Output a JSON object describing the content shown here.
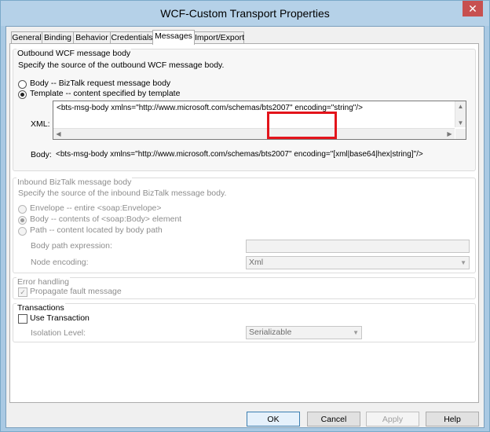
{
  "window": {
    "title": "WCF-Custom Transport Properties",
    "close_glyph": "✕"
  },
  "tabs": [
    "General",
    "Binding",
    "Behavior",
    "Credentials",
    "Messages",
    "Import/Export"
  ],
  "active_tab": "Messages",
  "outbound": {
    "title": "Outbound WCF message body",
    "description": "Specify the source of the outbound WCF message body.",
    "option_body": "Body -- BizTalk request message body",
    "option_template": "Template -- content specified by template",
    "selected": "template",
    "xml_label": "XML:",
    "xml_value": "<bts-msg-body xmlns=\"http://www.microsoft.com/schemas/bts2007\" encoding=\"string\"/>",
    "body_label": "Body:",
    "body_value": "<bts-msg-body xmlns=\"http://www.microsoft.com/schemas/bts2007\" encoding=\"[xml|base64|hex|string]\"/>"
  },
  "inbound": {
    "title": "Inbound BizTalk message body",
    "description": "Specify the source of the inbound BizTalk message body.",
    "option_envelope": "Envelope -- entire <soap:Envelope>",
    "option_body": "Body -- contents of <soap:Body> element",
    "option_path": "Path -- content located by body path",
    "selected": "body",
    "body_path_label": "Body path expression:",
    "body_path_value": "",
    "node_encoding_label": "Node encoding:",
    "node_encoding_value": "Xml"
  },
  "error_handling": {
    "title": "Error handling",
    "propagate_label": "Propagate fault message",
    "propagate_checked": true
  },
  "transactions": {
    "title": "Transactions",
    "use_transaction_label": "Use Transaction",
    "use_transaction_checked": false,
    "isolation_label": "Isolation Level:",
    "isolation_value": "Serializable"
  },
  "buttons": {
    "ok": "OK",
    "cancel": "Cancel",
    "apply": "Apply",
    "help": "Help"
  },
  "colors": {
    "highlight": "#e3141b",
    "title_bar": "#b5d1e8",
    "close_button": "#c75050"
  }
}
